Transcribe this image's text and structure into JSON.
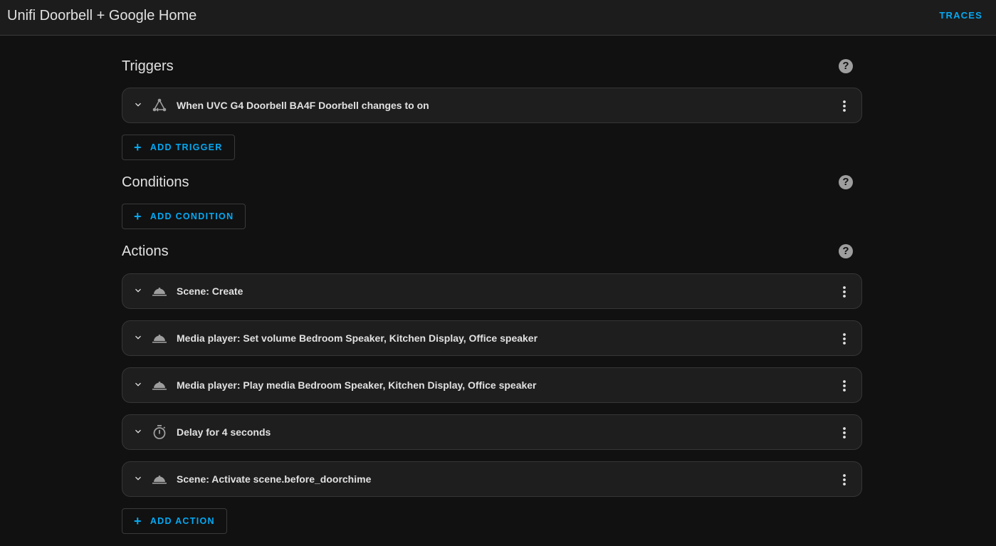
{
  "header": {
    "title": "Unifi Doorbell + Google Home",
    "traces_label": "TRACES"
  },
  "colors": {
    "accent": "#03a9f4",
    "background": "#111111",
    "card": "#1e1e1e",
    "icon": "#9e9e9e"
  },
  "triggers": {
    "heading": "Triggers",
    "help_icon": "help-circle-icon",
    "items": [
      {
        "icon": "state-change-icon",
        "label": "When UVC G4 Doorbell BA4F Doorbell changes to on"
      }
    ],
    "add_label": "ADD TRIGGER"
  },
  "conditions": {
    "heading": "Conditions",
    "help_icon": "help-circle-icon",
    "items": [],
    "add_label": "ADD CONDITION"
  },
  "actions": {
    "heading": "Actions",
    "help_icon": "help-circle-icon",
    "items": [
      {
        "icon": "service-bell-icon",
        "label": "Scene: Create"
      },
      {
        "icon": "service-bell-icon",
        "label": "Media player: Set volume Bedroom Speaker, Kitchen Display, Office speaker"
      },
      {
        "icon": "service-bell-icon",
        "label": "Media player: Play media Bedroom Speaker, Kitchen Display, Office speaker"
      },
      {
        "icon": "timer-icon",
        "label": "Delay for 4 seconds"
      },
      {
        "icon": "service-bell-icon",
        "label": "Scene: Activate scene.before_doorchime"
      }
    ],
    "add_label": "ADD ACTION"
  }
}
